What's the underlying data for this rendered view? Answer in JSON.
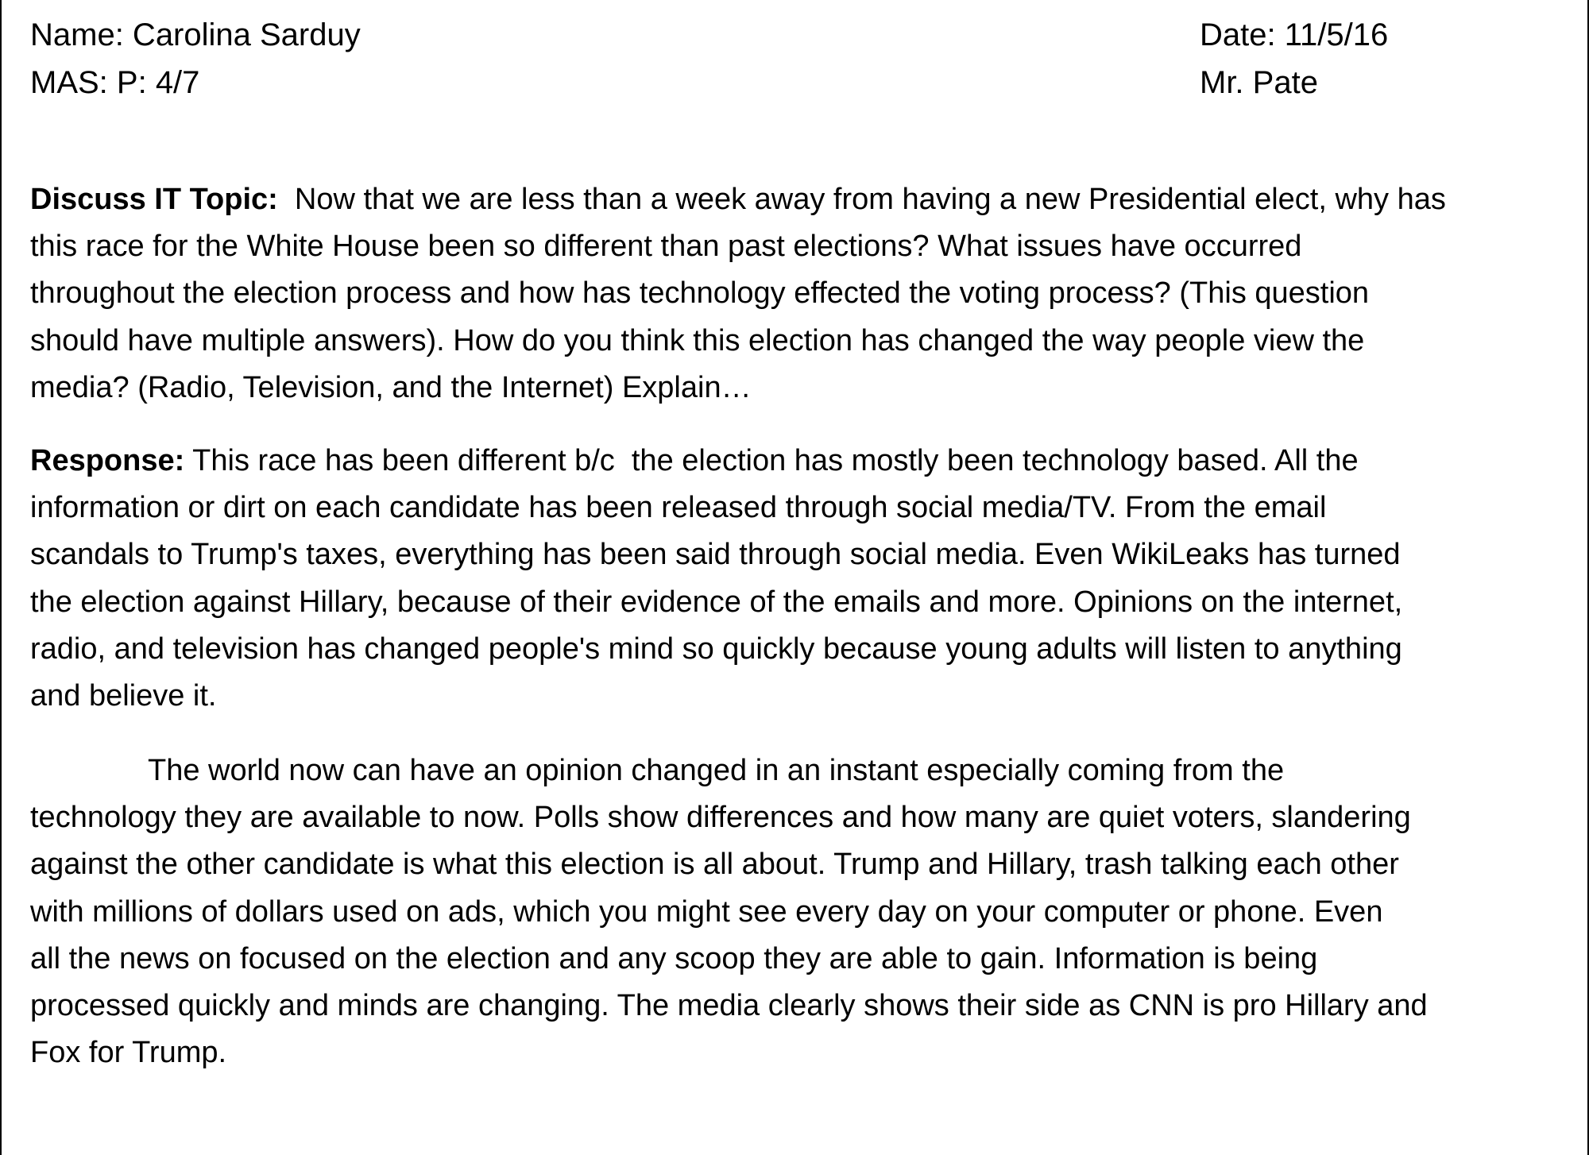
{
  "header": {
    "name": "Name: Carolina Sarduy",
    "mas": "MAS: P: 4/7",
    "date": "Date: 11/5/16",
    "teacher": "Mr. Pate"
  },
  "topic": {
    "lead": "Discuss IT Topic:",
    "lines": [
      "  Now that we are less than a week away from having a new Presidential elect, why has",
      "this race for the White House been so different than past elections? What issues have occurred",
      "throughout the election process and how has technology effected the voting process? (This question",
      "should have multiple answers). How do you think this election has changed the way people view the",
      "media? (Radio, Television, and the Internet) Explain…"
    ]
  },
  "response": {
    "lead": "Response:",
    "lines": [
      " This race has been different b/c  the election has mostly been technology based. All the",
      "information or dirt on each candidate has been released through social media/TV.  From the email",
      "scandals to Trump's taxes, everything has been said through social media. Even WikiLeaks has turned",
      "the election against Hillary, because of their evidence of the emails and more. Opinions on the internet,",
      "radio, and television has changed people's mind so quickly because young adults will listen to anything",
      "and believe it."
    ]
  },
  "body": {
    "lines": [
      "The world now can have an opinion changed in an instant especially coming from the",
      "technology they are available to now. Polls show differences and how many are quiet voters, slandering",
      "against the other candidate is what this election is all about. Trump and Hillary, trash talking each other",
      "with millions of dollars used on ads, which you might see every day on your computer or phone.  Even",
      "all the news on focused on the election and any scoop they are able to gain. Information is being",
      "processed quickly and minds are changing. The media clearly shows their side as CNN is pro Hillary and",
      "Fox for Trump."
    ]
  }
}
